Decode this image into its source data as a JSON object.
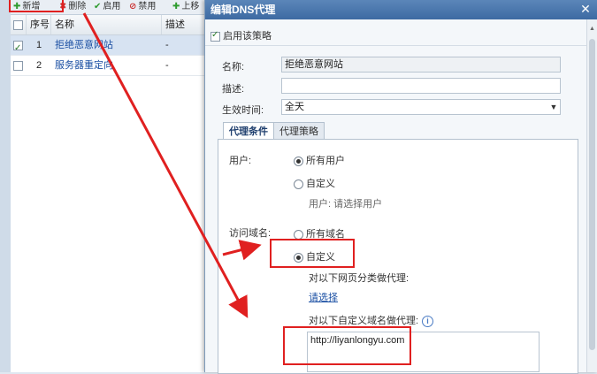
{
  "toolbar": {
    "add": "新增",
    "delete": "删除",
    "enable": "启用",
    "disable": "禁用",
    "up": "上移"
  },
  "grid": {
    "columns": [
      "序号",
      "名称",
      "描述"
    ],
    "rows": [
      {
        "index": "1",
        "name": "拒绝恶意网站",
        "desc": "-",
        "checked": true
      },
      {
        "index": "2",
        "name": "服务器重定向",
        "desc": "-",
        "checked": false
      }
    ]
  },
  "dialog": {
    "title": "编辑DNS代理",
    "enable_policy": "启用该策略",
    "name_label": "名称:",
    "name_value": "拒绝恶意网站",
    "desc_label": "描述:",
    "desc_value": "",
    "time_label": "生效时间:",
    "time_value": "全天",
    "tabs": [
      "代理条件",
      "代理策略"
    ],
    "user_label": "用户:",
    "user_all": "所有用户",
    "user_custom": "自定义",
    "user_hint": "用户: 请选择用户",
    "domain_label": "访问域名:",
    "domain_all": "所有域名",
    "domain_custom": "自定义",
    "category_label": "对以下网页分类做代理:",
    "select_link": "请选择",
    "custom_domain_label": "对以下自定义域名做代理:",
    "custom_domain_value": "http://liyanlongyu.com"
  },
  "colors": {
    "title_bar": "#4a77ad",
    "annotation": "#e02020",
    "link": "#1a4fa3"
  }
}
